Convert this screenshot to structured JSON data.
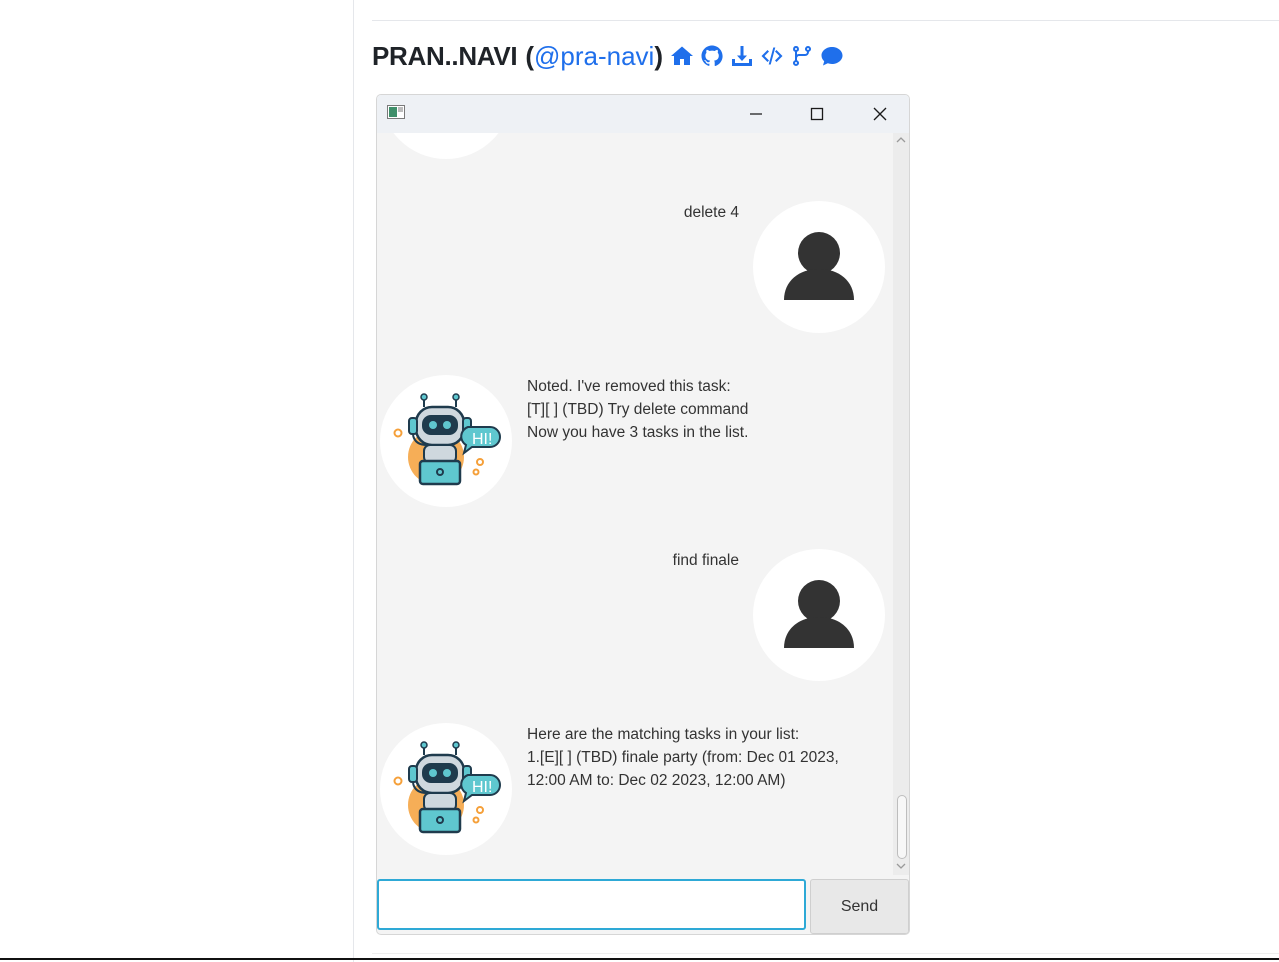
{
  "header": {
    "name": "PRAN..NAVI",
    "open_paren": "(",
    "handle": "@pra-navi",
    "close_paren": ")",
    "icons": [
      "home-icon",
      "github-icon",
      "download-icon",
      "code-icon",
      "fork-icon",
      "comment-icon"
    ]
  },
  "colors": {
    "link": "#1f6feb",
    "input_focus": "#2ea9d6",
    "chat_bg": "#f4f4f4"
  },
  "window": {
    "controls": [
      "minimize-icon",
      "maximize-icon",
      "close-icon"
    ]
  },
  "chat": {
    "messages": [
      {
        "sender": "user",
        "text": "delete 4"
      },
      {
        "sender": "bot",
        "text": "Noted. I've removed this task:\n[T][ ] (TBD) Try delete command\nNow you have 3 tasks in the list."
      },
      {
        "sender": "user",
        "text": "find finale"
      },
      {
        "sender": "bot",
        "text": "Here are the matching tasks in your list:\n1.[E][ ] (TBD) finale party  (from: Dec 01 2023,\n12:00 AM to: Dec 02 2023, 12:00 AM)"
      }
    ],
    "bot_avatar_label": "HI!"
  },
  "input": {
    "value": "",
    "placeholder": ""
  },
  "send_label": "Send"
}
